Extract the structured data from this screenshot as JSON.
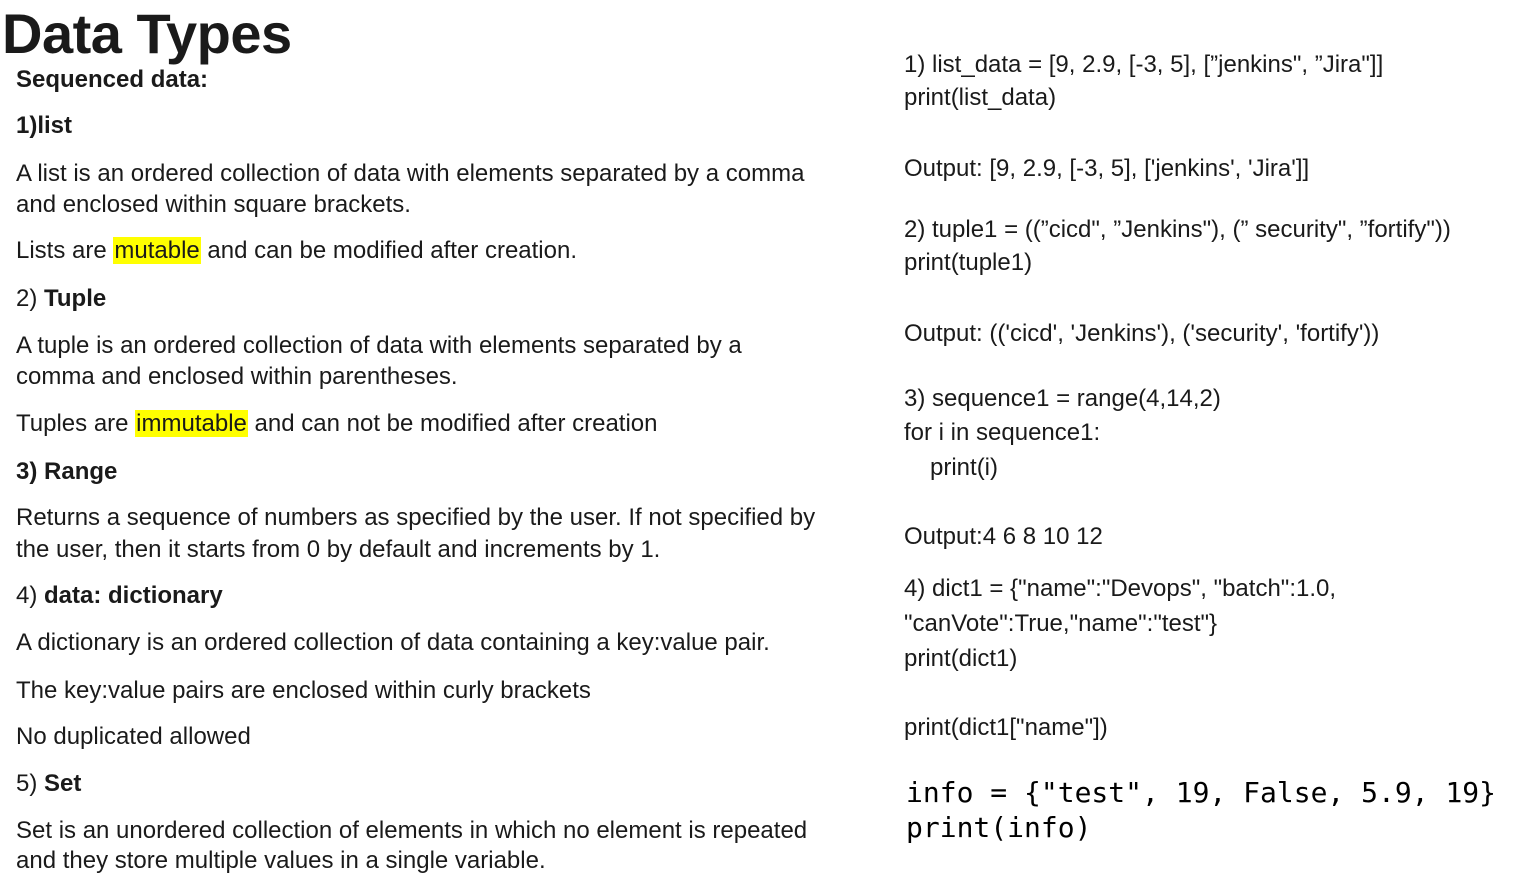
{
  "title": "Data Types",
  "left": {
    "sequenced_heading": "Sequenced data:",
    "list": {
      "heading": "1)list",
      "desc_line1": "A list is an ordered collection of data with elements separated by a comma",
      "desc_line2": "and enclosed within square brackets.",
      "mut_prefix": "Lists are ",
      "mut_word": "mutable",
      "mut_suffix": " and can be modified after creation."
    },
    "tuple": {
      "num": "2) ",
      "heading": "Tuple",
      "desc_line1": "A tuple is an ordered collection of data with elements separated by a",
      "desc_line2": "comma and enclosed within parentheses.",
      "mut_prefix": "Tuples are ",
      "mut_word": "immutable",
      "mut_suffix": " and can not be modified after creation"
    },
    "range": {
      "heading": "3) Range",
      "desc_line1": "Returns a sequence of numbers as specified by the user. If not specified by",
      "desc_line2": "the user, then it starts from 0 by default and increments by 1."
    },
    "dict": {
      "num": "4) ",
      "heading": "data: dictionary",
      "desc_line1": "A dictionary is an ordered collection of data containing a key:value pair.",
      "desc_line2": "The key:value pairs are enclosed within curly brackets",
      "desc_line3": "No duplicated allowed"
    },
    "set": {
      "num": "5) ",
      "heading": "Set",
      "desc_line1": "Set is an unordered collection of elements in which no element is repeated",
      "desc_line2": "and they store multiple values in a single variable."
    }
  },
  "right": {
    "ex1_line1": "1) list_data = [9, 2.9, [-3, 5], [”jenkins\", ”Jira\"]]",
    "ex1_line2": "print(list_data)",
    "ex1_output": "Output: [9, 2.9, [-3, 5], ['jenkins', 'Jira']]",
    "ex2_line1": "2) tuple1 = ((”cicd\", ”Jenkins\"), (” security\", ”fortify\"))",
    "ex2_line2": "print(tuple1)",
    "ex2_output": "Output: (('cicd', 'Jenkins'), ('security', 'fortify'))",
    "ex3_line1": "3) sequence1 = range(4,14,2)",
    "ex3_line2": "for i in sequence1:",
    "ex3_line3": "print(i)",
    "ex3_output": "Output:4 6 8 10 12",
    "ex4_line1": "4) dict1 = {\"name\":\"Devops\", \"batch\":1.0,",
    "ex4_line2": "\"canVote\":True,\"name\":\"test\"}",
    "ex4_line3": "print(dict1)",
    "ex4_line4": "print(dict1[\"name\"])",
    "ex5_line1": "info = {\"test\", 19, False, 5.9, 19}",
    "ex5_line2": "print(info)"
  },
  "colors": {
    "highlight": "#ffff00",
    "text": "#1a1a1a"
  }
}
